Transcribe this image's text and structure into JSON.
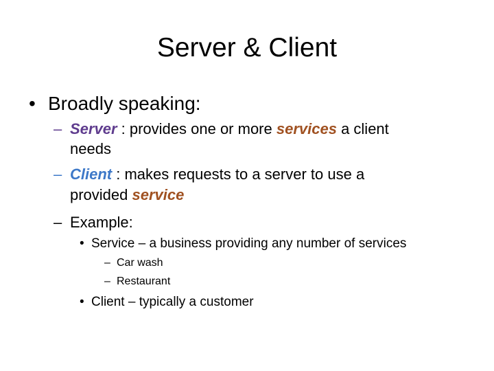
{
  "slide": {
    "title": "Server & Client",
    "bullet_symbol": "•",
    "dash_symbol": "–",
    "colors": {
      "server_term": "#5f3c8e",
      "client_term": "#3d78c8",
      "service_term": "#a05121"
    },
    "point1": {
      "text": "Broadly speaking:",
      "sub": [
        {
          "term": "Server",
          "text_a": " : provides one or more ",
          "emphasis": "services",
          "text_b": " a client",
          "continuation": "needs"
        },
        {
          "term": "Client",
          "text_a": " : makes requests to a server to use a",
          "continuation_a": "provided ",
          "emphasis": "service"
        },
        {
          "text": "Example:",
          "items": [
            {
              "text": "Service – a business providing any number of services",
              "subitems": [
                "Car wash",
                "Restaurant"
              ]
            },
            {
              "text": "Client – typically a customer"
            }
          ]
        }
      ]
    }
  }
}
